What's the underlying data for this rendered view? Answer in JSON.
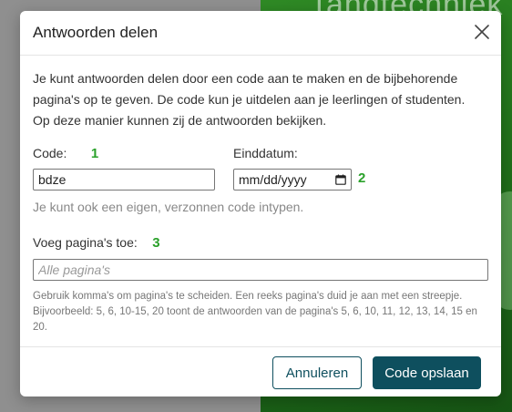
{
  "background": {
    "banner_text": "Tandtechniek"
  },
  "dialog": {
    "title": "Antwoorden delen",
    "intro_line1": "Je kunt antwoorden delen door een code aan te maken en de bijbehorende",
    "intro_line2": "pagina's op te geven. De code kun je uitdelen aan je leerlingen of studenten.",
    "intro_line3": "Op deze manier kunnen zij de antwoorden bekijken.",
    "code_label": "Code:",
    "code_marker": "1",
    "code_value": "bdze",
    "date_label": "Einddatum:",
    "date_marker": "2",
    "date_placeholder": "mm/dd/yyyy",
    "hint": "Je kunt ook een eigen, verzonnen code intypen.",
    "pages_label": "Voeg pagina's toe:",
    "pages_marker": "3",
    "pages_placeholder": "Alle pagina's",
    "help_text": "Gebruik komma's om pagina's te scheiden. Een reeks pagina's duid je aan met een streepje. Bijvoorbeeld: 5, 6, 10-15, 20 toont de antwoorden van de pagina's 5, 6, 10, 11, 12, 13, 14, 15 en 20.",
    "cancel_label": "Annuleren",
    "save_label": "Code opslaan"
  },
  "colors": {
    "primary": "#0e4f5e",
    "marker": "#2aa12a",
    "background_green": "#1f6d19"
  },
  "icons": {
    "close": "close-icon",
    "calendar": "calendar-icon"
  }
}
